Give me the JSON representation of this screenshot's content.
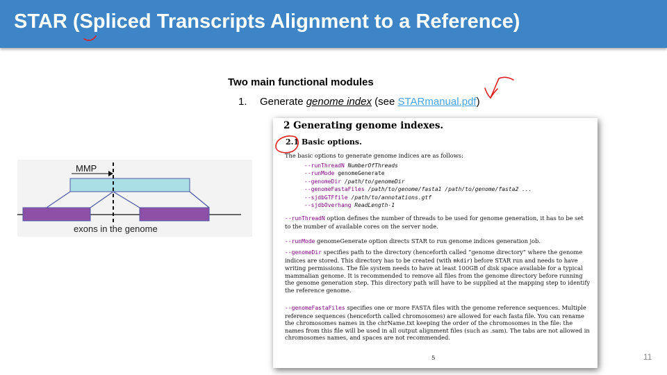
{
  "slide": {
    "title": "STAR (Spliced Transcripts Alignment to a Reference)",
    "number": "11"
  },
  "content": {
    "subtitle": "Two main functional modules",
    "item_number": "1.",
    "item_text_pre": "Generate ",
    "item_text_em": "genome index",
    "item_text_mid": " (see ",
    "item_link": "STARmanual.pdf",
    "item_text_post": ")"
  },
  "diagram": {
    "label_mmp": "MMP",
    "caption": "exons in the genome",
    "colors": {
      "read": "#aadfe6",
      "exon": "#8e4fa6",
      "line": "#4f5aa6"
    }
  },
  "manual": {
    "section_heading": "2    Generating genome indexes.",
    "subsection_heading": "2.1    Basic options.",
    "intro": "The basic options to generate genome indices are as follows:",
    "options": [
      {
        "cmd": "--runThreadN",
        "arg": "NumberOfThreads"
      },
      {
        "cmd": "--runMode",
        "arg": "genomeGenerate"
      },
      {
        "cmd": "--genomeDir",
        "arg": "/path/to/genomeDir"
      },
      {
        "cmd": "--genomeFastaFiles",
        "arg": "/path/to/genome/fasta1 /path/to/genome/fasta2 ..."
      },
      {
        "cmd": "--sjdbGTFfile",
        "arg": "/path/to/annotations.gtf"
      },
      {
        "cmd": "--sjdbOverhang",
        "arg": "ReadLength-1"
      }
    ],
    "p1_cmd": "--runThreadN",
    "p1_text": " option defines the number of threads to be used for genome generation, it has to be set to the number of available cores on the server node.",
    "p2_cmd": "--runMode",
    "p2_text": " genomeGenerate option directs STAR to run genome indices generation job.",
    "p3_cmd": "--genomeDir",
    "p3_text1": " specifies path to the directory (henceforth called ”genome directory” where the genome indices are stored. This directory has to be created (with ",
    "p3_mono": "mkdir",
    "p3_text2": ") before STAR run and needs to have writing permissions. The file system needs to have at least 100GB of disk space available for a typical mammalian genome. It is recommended to remove all files from the genome directory before running the genome generation step. This directory path will have to be supplied at the mapping step to identify the reference genome.",
    "p4_cmd": "--genomeFastaFiles",
    "p4_text": " specifies one or more FASTA files with the genome reference sequences. Multiple reference sequences (henceforth called chromosomes) are allowed for each fasta file. You can rename the chromosomes names in the chrName.txt keeping the order of the chromosomes in the file: the names from this file will be used in all output alignment files (such as .sam). The tabs are not allowed in chromosomes names, and spaces are not recommended.",
    "page_number": "5"
  }
}
